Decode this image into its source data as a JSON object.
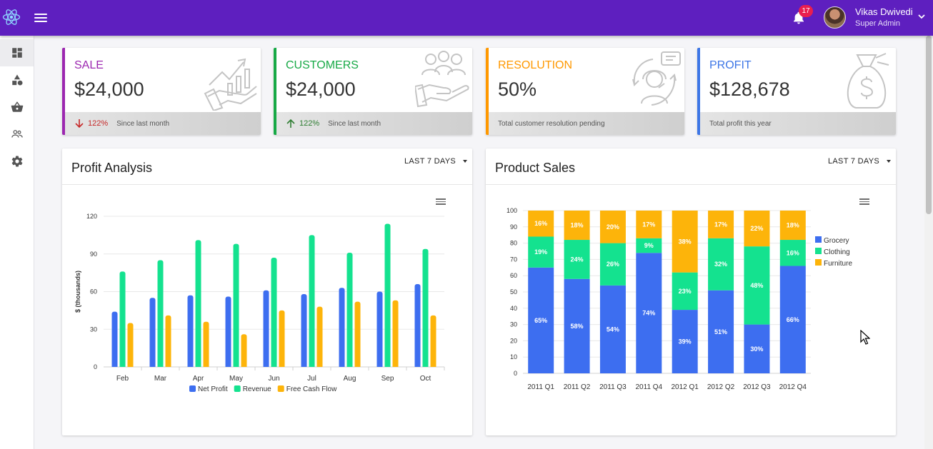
{
  "header": {
    "notification_count": "17",
    "user_name": "Vikas Dwivedi",
    "user_role": "Super Admin"
  },
  "sidebar": {
    "items": [
      {
        "icon": "dashboard-icon",
        "active": true
      },
      {
        "icon": "shapes-icon",
        "active": false
      },
      {
        "icon": "basket-icon",
        "active": false
      },
      {
        "icon": "people-icon",
        "active": false
      },
      {
        "icon": "settings-icon",
        "active": false
      }
    ]
  },
  "stats": [
    {
      "title": "SALE",
      "value": "$24,000",
      "color": "#9c27b0",
      "trend": "down",
      "trend_color": "#c62828",
      "pct": "122%",
      "note": "Since last month",
      "icon": "hand-growth-chart-icon"
    },
    {
      "title": "CUSTOMERS",
      "value": "$24,000",
      "color": "#17a946",
      "trend": "up",
      "trend_color": "#2e7d32",
      "pct": "122%",
      "note": "Since last month",
      "icon": "hand-people-icon"
    },
    {
      "title": "RESOLUTION",
      "value": "50%",
      "color": "#ff9800",
      "trend": null,
      "pct": "",
      "note": "Total customer resolution pending",
      "icon": "support-agent-icon"
    },
    {
      "title": "PROFIT",
      "value": "$128,678",
      "color": "#3d76e6",
      "trend": null,
      "pct": "",
      "note": "Total profit this year",
      "icon": "money-bag-icon"
    }
  ],
  "profit_panel": {
    "title": "Profit Analysis",
    "range_label": "LAST 7 DAYS"
  },
  "sales_panel": {
    "title": "Product Sales",
    "range_label": "LAST 7 DAYS"
  },
  "colors": {
    "blue": "#3d6ef0",
    "green": "#14e28f",
    "orange": "#fdb40a",
    "brand": "#5e1fbf"
  },
  "chart_data": [
    {
      "type": "bar",
      "categories": [
        "Feb",
        "Mar",
        "Apr",
        "May",
        "Jun",
        "Jul",
        "Aug",
        "Sep",
        "Oct"
      ],
      "series": [
        {
          "name": "Net Profit",
          "color": "#3d6ef0",
          "values": [
            44,
            55,
            57,
            56,
            61,
            58,
            63,
            60,
            66
          ]
        },
        {
          "name": "Revenue",
          "color": "#14e28f",
          "values": [
            76,
            85,
            101,
            98,
            87,
            105,
            91,
            114,
            94
          ]
        },
        {
          "name": "Free Cash Flow",
          "color": "#fdb40a",
          "values": [
            35,
            41,
            36,
            26,
            45,
            48,
            52,
            53,
            41
          ]
        }
      ],
      "ylabel": "$ (thousands)",
      "ylim": [
        0,
        120
      ],
      "yticks": [
        0,
        30,
        60,
        90,
        120
      ],
      "grid": true,
      "legend": "bottom"
    },
    {
      "type": "bar",
      "stacked": true,
      "categories": [
        "2011 Q1",
        "2011 Q2",
        "2011 Q3",
        "2011 Q4",
        "2012 Q1",
        "2012 Q2",
        "2012 Q3",
        "2012 Q4"
      ],
      "series": [
        {
          "name": "Grocery",
          "color": "#3d6ef0",
          "values": [
            65,
            58,
            54,
            74,
            39,
            51,
            30,
            66
          ]
        },
        {
          "name": "Clothing",
          "color": "#14e28f",
          "values": [
            19,
            24,
            26,
            9,
            23,
            32,
            48,
            16
          ]
        },
        {
          "name": "Furniture",
          "color": "#fdb40a",
          "values": [
            16,
            18,
            20,
            17,
            38,
            17,
            22,
            18
          ]
        }
      ],
      "ylim": [
        0,
        100
      ],
      "yticks": [
        0,
        10,
        20,
        30,
        40,
        50,
        60,
        70,
        80,
        90,
        100
      ],
      "grid": true,
      "legend": "right"
    }
  ]
}
